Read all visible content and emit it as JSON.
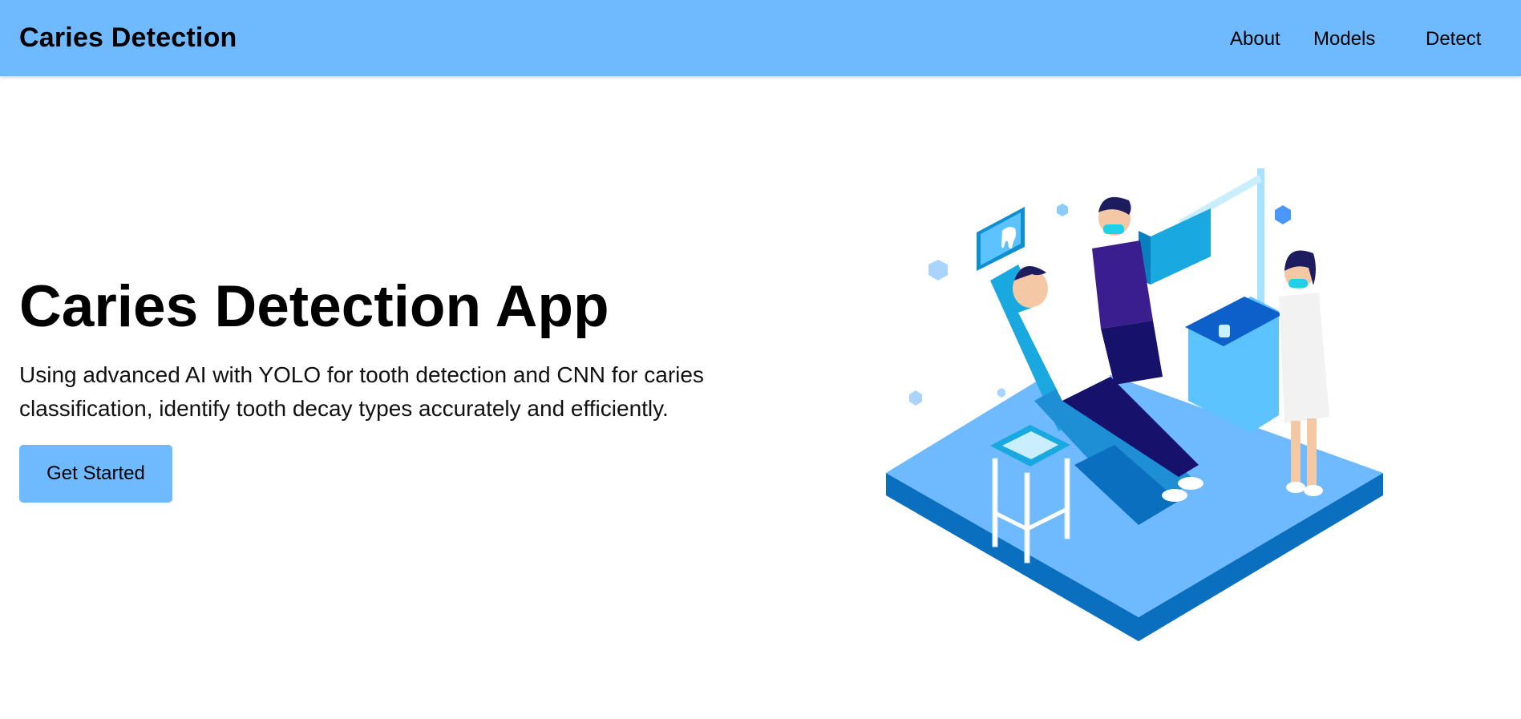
{
  "navbar": {
    "brand": "Caries Detection",
    "links": [
      {
        "label": "About"
      },
      {
        "label": "Models"
      },
      {
        "label": "Detect"
      }
    ],
    "background": "#6fbaff"
  },
  "hero": {
    "title": "Caries Detection App",
    "description": "Using advanced AI with YOLO for tooth detection and CNN for caries classification, identify tooth decay types accurately and efficiently.",
    "cta_label": "Get Started",
    "accent": "#6fbaff"
  },
  "illustration": {
    "icon": "dentist-clinic-illustration"
  }
}
